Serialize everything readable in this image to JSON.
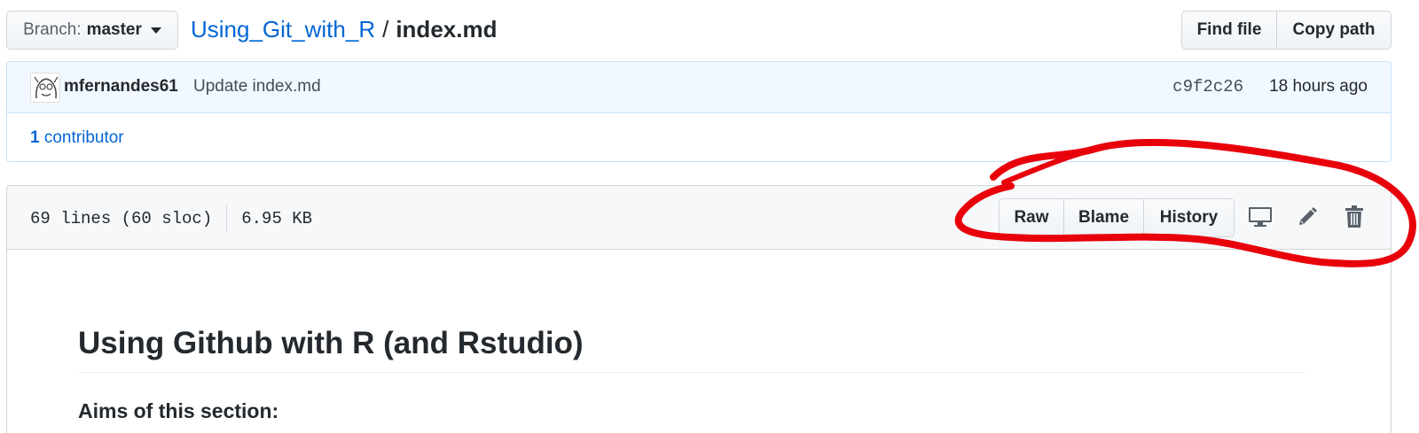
{
  "branch": {
    "label": "Branch:",
    "value": "master"
  },
  "breadcrumb": {
    "repo": "Using_Git_with_R",
    "separator": "/",
    "file": "index.md"
  },
  "file_nav": {
    "find_file": "Find file",
    "copy_path": "Copy path"
  },
  "commit": {
    "author": "mfernandes61",
    "message": "Update index.md",
    "sha": "c9f2c26",
    "time": "18 hours ago"
  },
  "contributors": {
    "count": "1",
    "label": "contributor"
  },
  "file_info": {
    "lines": "69 lines (60 sloc)",
    "size": "6.95 KB"
  },
  "file_actions": {
    "raw": "Raw",
    "blame": "Blame",
    "history": "History"
  },
  "icons": {
    "desktop": "desktop-icon",
    "edit": "pencil-icon",
    "delete": "trash-icon"
  },
  "content": {
    "h1": "Using Github with R (and Rstudio)",
    "h3": "Aims of this section:"
  },
  "colors": {
    "link": "#0366d6",
    "annotation": "#e8000b"
  }
}
